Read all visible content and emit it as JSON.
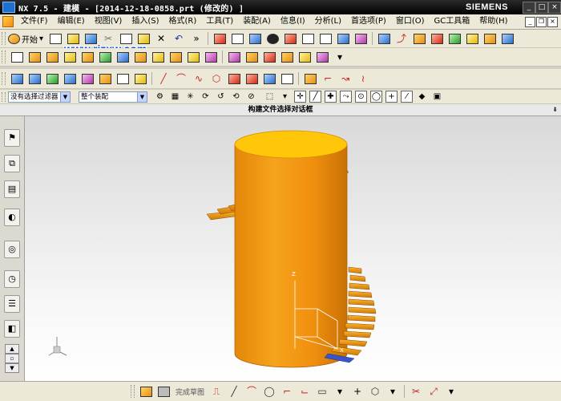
{
  "app": {
    "title": "NX 7.5 - 建模 - [2014-12-18-0858.prt  (修改的) ]",
    "brand": "SIEMENS"
  },
  "menu": [
    {
      "label": "文件(F)"
    },
    {
      "label": "编辑(E)"
    },
    {
      "label": "视图(V)"
    },
    {
      "label": "插入(S)"
    },
    {
      "label": "格式(R)"
    },
    {
      "label": "工具(T)"
    },
    {
      "label": "装配(A)"
    },
    {
      "label": "信息(I)"
    },
    {
      "label": "分析(L)"
    },
    {
      "label": "首选项(P)"
    },
    {
      "label": "窗口(O)"
    },
    {
      "label": "GC工具箱"
    },
    {
      "label": "帮助(H)"
    }
  ],
  "toolbar": {
    "start_label": "开始"
  },
  "watermark": "www.rjzxw.com",
  "filters": {
    "type_filter": "没有选择过滤器",
    "scope_filter": "整个装配"
  },
  "cue_line": "构建文件选择对话框",
  "status": {
    "finish_sketch": "完成草图"
  },
  "colors": {
    "model_orange": "#f29a0c",
    "cylinder_top": "#ffc60a",
    "watermark_blue": "#1450d8",
    "title_bar": "#000000"
  }
}
